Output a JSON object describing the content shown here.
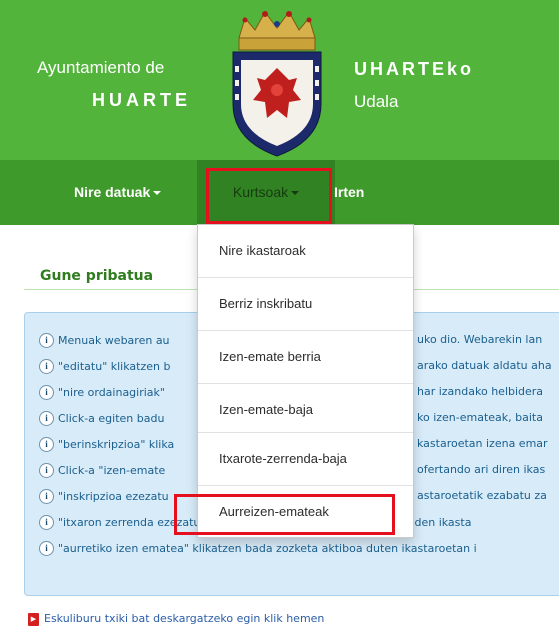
{
  "brand": {
    "left_line1": "Ayuntamiento de",
    "left_line2": "HUARTE",
    "right_line1": "UHARTEko",
    "right_line2": "Udala"
  },
  "nav": {
    "items": [
      {
        "label": "Nire datuak"
      },
      {
        "label": "Kurtsoak"
      },
      {
        "label": "Irten"
      }
    ]
  },
  "section": {
    "title": "Gune pribatua"
  },
  "dropdown": {
    "items": [
      {
        "label": "Nire ikastaroak"
      },
      {
        "label": "Berriz inskribatu"
      },
      {
        "label": "Izen-emate berria"
      },
      {
        "label": "Izen-emate-baja"
      },
      {
        "label": "Itxarote-zerrenda-baja"
      },
      {
        "label": "Aurreizen-emateak"
      }
    ]
  },
  "info": {
    "lines": [
      {
        "text": "Menuak webaren au"
      },
      {
        "text": "\"editatu\" klikatzen b"
      },
      {
        "text": "\"nire ordainagiriak\""
      },
      {
        "text": "Click-a egiten badu"
      },
      {
        "text": "\"berinskripzioa\" klika"
      },
      {
        "text": "Click-a \"izen-emate"
      },
      {
        "text": "\"inskripzioa ezezatu"
      },
      {
        "text": "\"itxaron zerrenda ezezatu\" klikatzen bada itxaron zerrendan dauden ikasta"
      },
      {
        "text": "\"aurretiko izen ematea\" klikatzen bada zozketa aktiboa duten ikastaroetan i"
      }
    ],
    "right_fragments": [
      {
        "text": "uko dio. Webarekin lan"
      },
      {
        "text": "arako datuak aldatu aha"
      },
      {
        "text": "har izandako helbidera"
      },
      {
        "text": "ko izen-emateak, baita"
      },
      {
        "text": "kastaroetan izena emar"
      },
      {
        "text": "ofertando ari diren ikas"
      },
      {
        "text": "astaroetatik ezabatu za"
      }
    ]
  },
  "footer": {
    "link_text": "Eskuliburu txiki bat deskargatzeko egin klik hemen"
  },
  "colors": {
    "header_green": "#52b43b",
    "nav_green": "#3e9a2a",
    "highlight_red": "#e4101d",
    "info_bg": "#d8ebf8"
  }
}
